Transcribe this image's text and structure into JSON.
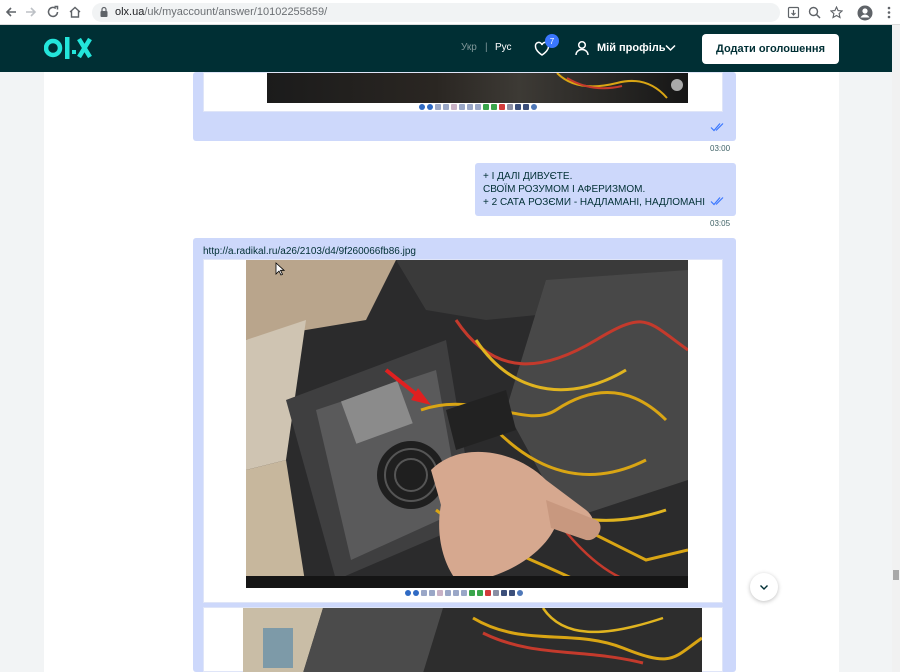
{
  "browser": {
    "url_host": "olx.ua",
    "url_path": "/uk/myaccount/answer/10102255859/"
  },
  "header": {
    "lang_ukr": "Укр",
    "lang_sep": "|",
    "lang_rus": "Рус",
    "favorites_count": "7",
    "profile_label": "Мій профіль",
    "add_button_label": "Додати оголошення"
  },
  "messages": [
    {
      "time": "03:00"
    },
    {
      "text": "+ І ДАЛІ ДИВУЄТЕ.\nСВОЇМ РОЗУМОМ І АФЕРИЗМОМ.\n+ 2 САТА РОЗЄМИ - НАДЛАМАНІ, НАДЛОМАНІ",
      "time": "03:05"
    },
    {
      "link": "http://a.radikal.ru/a26/2103/d4/9f260066fb86.jpg"
    }
  ],
  "colors": {
    "header_bg": "#002f34",
    "bubble_bg": "#cdd8fb",
    "accent_teal": "#23e5db",
    "badge": "#3a77ff"
  }
}
